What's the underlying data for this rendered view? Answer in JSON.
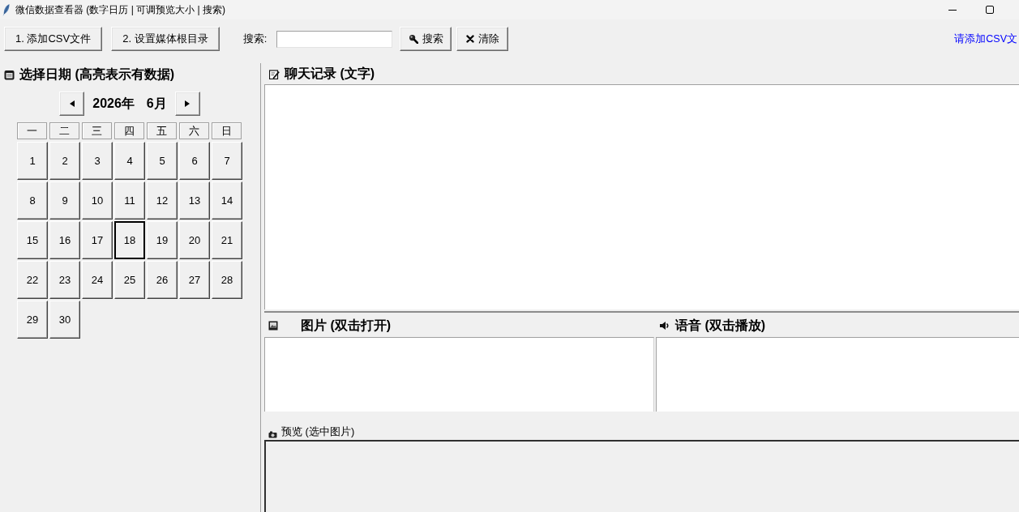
{
  "window": {
    "title": "微信数据查看器 (数字日历 | 可调预览大小 | 搜索)"
  },
  "toolbar": {
    "buttons": [
      {
        "label": "1. 添加CSV文件"
      },
      {
        "label": "2. 设置媒体根目录"
      }
    ],
    "search": {
      "label": "搜索:",
      "buttons": [
        {
          "kind": "search",
          "label": "搜索"
        },
        {
          "kind": "clear",
          "label": "清除"
        }
      ]
    },
    "status": "请添加CSV文"
  },
  "calendar": {
    "title": "选择日期 (高亮表示有数据)",
    "year": "2026年",
    "month": "6月",
    "weekdays": [
      "一",
      "二",
      "三",
      "四",
      "五",
      "六",
      "日"
    ],
    "days": [
      {
        "label": "1",
        "selected": false
      },
      {
        "label": "2",
        "selected": false
      },
      {
        "label": "3",
        "selected": false
      },
      {
        "label": "4",
        "selected": false
      },
      {
        "label": "5",
        "selected": false
      },
      {
        "label": "6",
        "selected": false
      },
      {
        "label": "7",
        "selected": false
      },
      {
        "label": "8",
        "selected": false
      },
      {
        "label": "9",
        "selected": false
      },
      {
        "label": "10",
        "selected": false
      },
      {
        "label": "11",
        "selected": false
      },
      {
        "label": "12",
        "selected": false
      },
      {
        "label": "13",
        "selected": false
      },
      {
        "label": "14",
        "selected": false
      },
      {
        "label": "15",
        "selected": false
      },
      {
        "label": "16",
        "selected": false
      },
      {
        "label": "17",
        "selected": false
      },
      {
        "label": "18",
        "selected": true
      },
      {
        "label": "19",
        "selected": false
      },
      {
        "label": "20",
        "selected": false
      },
      {
        "label": "21",
        "selected": false
      },
      {
        "label": "22",
        "selected": false
      },
      {
        "label": "23",
        "selected": false
      },
      {
        "label": "24",
        "selected": false
      },
      {
        "label": "25",
        "selected": false
      },
      {
        "label": "26",
        "selected": false
      },
      {
        "label": "27",
        "selected": false
      },
      {
        "label": "28",
        "selected": false
      },
      {
        "label": "29",
        "selected": false
      },
      {
        "label": "30",
        "selected": false
      }
    ]
  },
  "chat": {
    "title": "聊天记录 (文字)"
  },
  "images": {
    "title": "图片 (双击打开)"
  },
  "voice": {
    "title": "语音 (双击播放)"
  },
  "preview": {
    "title": "预览 (选中图片)"
  }
}
